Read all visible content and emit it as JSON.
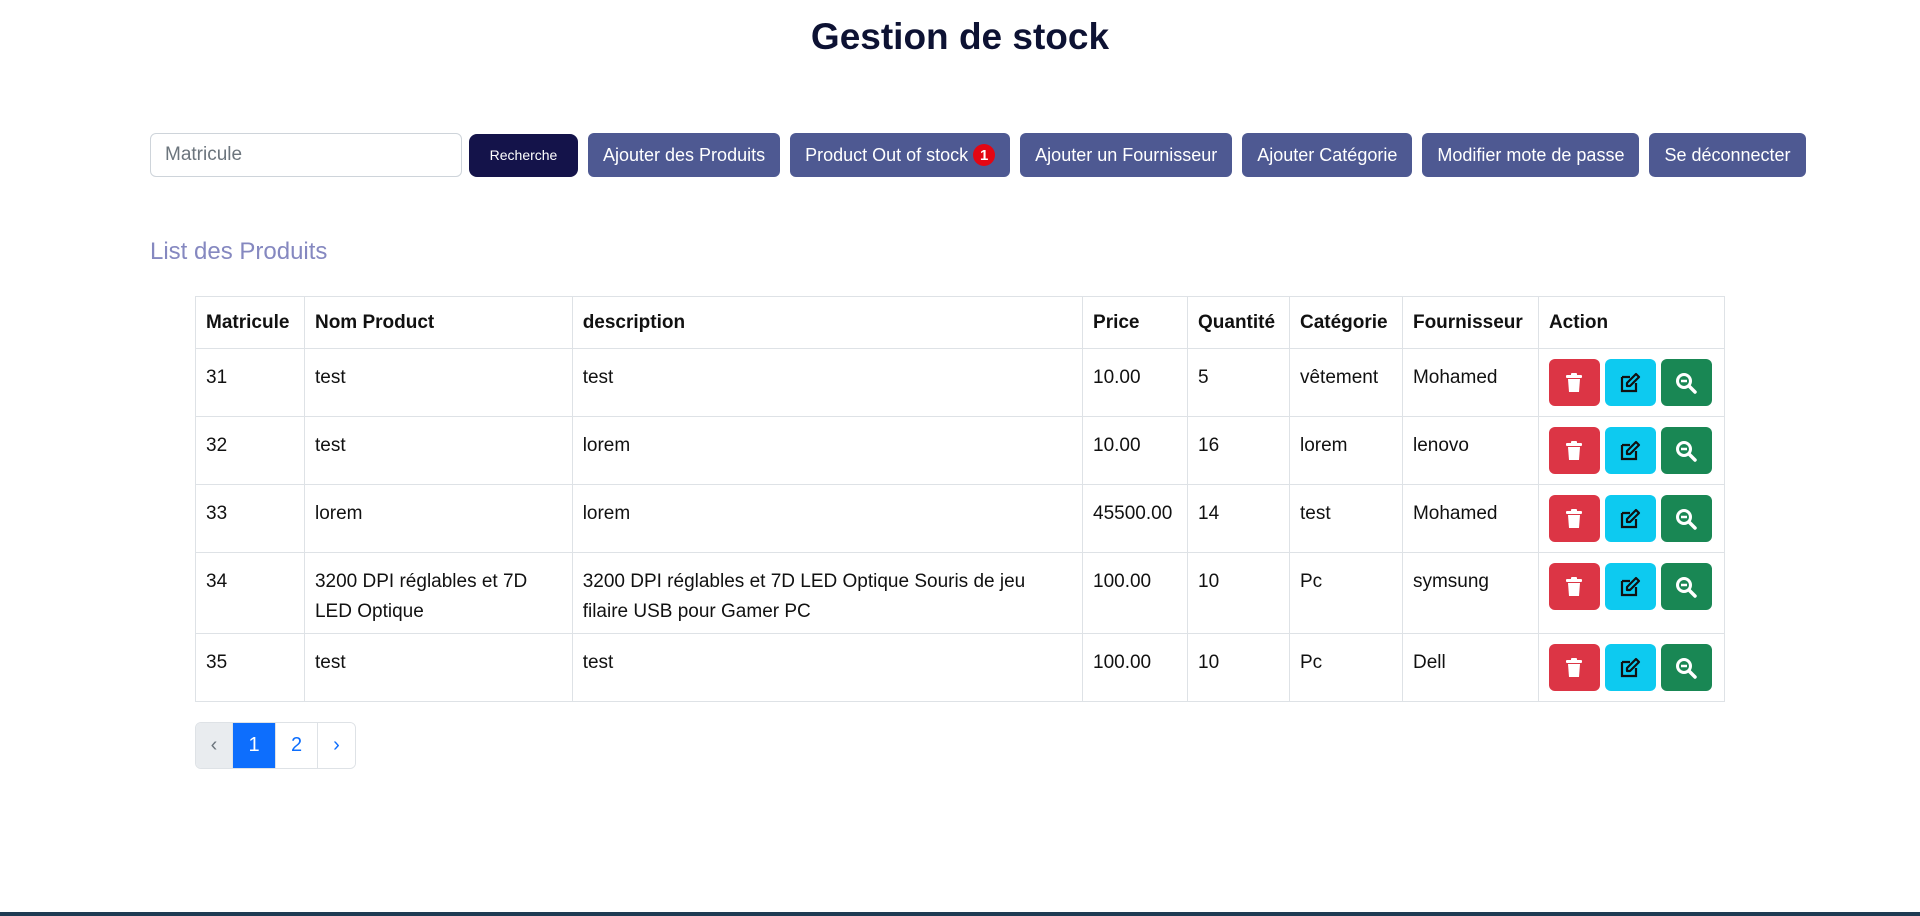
{
  "title": "Gestion de stock",
  "toolbar": {
    "search_placeholder": "Matricule",
    "search_value": "",
    "search_button": "Recherche",
    "add_products": "Ajouter des Produits",
    "out_of_stock": "Product Out of stock",
    "out_of_stock_count": "1",
    "add_supplier": "Ajouter un Fournisseur",
    "add_category": "Ajouter Catégorie",
    "change_password": "Modifier mote de passe",
    "logout": "Se déconnecter"
  },
  "section_title": "List des Produits",
  "table": {
    "headers": [
      "Matricule",
      "Nom Product",
      "description",
      "Price",
      "Quantité",
      "Catégorie",
      "Fournisseur",
      "Action"
    ],
    "rows": [
      [
        "31",
        "test",
        "test",
        "10.00",
        "5",
        "vêtement",
        "Mohamed"
      ],
      [
        "32",
        "test",
        "lorem",
        "10.00",
        "16",
        "lorem",
        "lenovo"
      ],
      [
        "33",
        "lorem",
        "lorem",
        "45500.00",
        "14",
        "test",
        "Mohamed"
      ],
      [
        "34",
        "3200 DPI réglables et 7D LED Optique",
        "3200 DPI réglables et 7D LED Optique Souris de jeu filaire USB pour Gamer PC",
        "100.00",
        "10",
        "Pc",
        "symsung"
      ],
      [
        "35",
        "test",
        "test",
        "100.00",
        "10",
        "Pc",
        "Dell"
      ]
    ],
    "action_icons": [
      "trash-icon",
      "edit-icon",
      "zoom-icon"
    ]
  },
  "pagination": {
    "prev": "‹",
    "pages": [
      "1",
      "2"
    ],
    "active": "1",
    "next": "›"
  },
  "colors": {
    "title": "#0d1233",
    "search_button": "#14134a",
    "nav_button": "#4e5992",
    "badge": "#e30613",
    "section_title": "#8588c0",
    "delete": "#dc3545",
    "edit": "#0dcaf0",
    "view": "#198754",
    "page_active": "#0d6efd"
  }
}
